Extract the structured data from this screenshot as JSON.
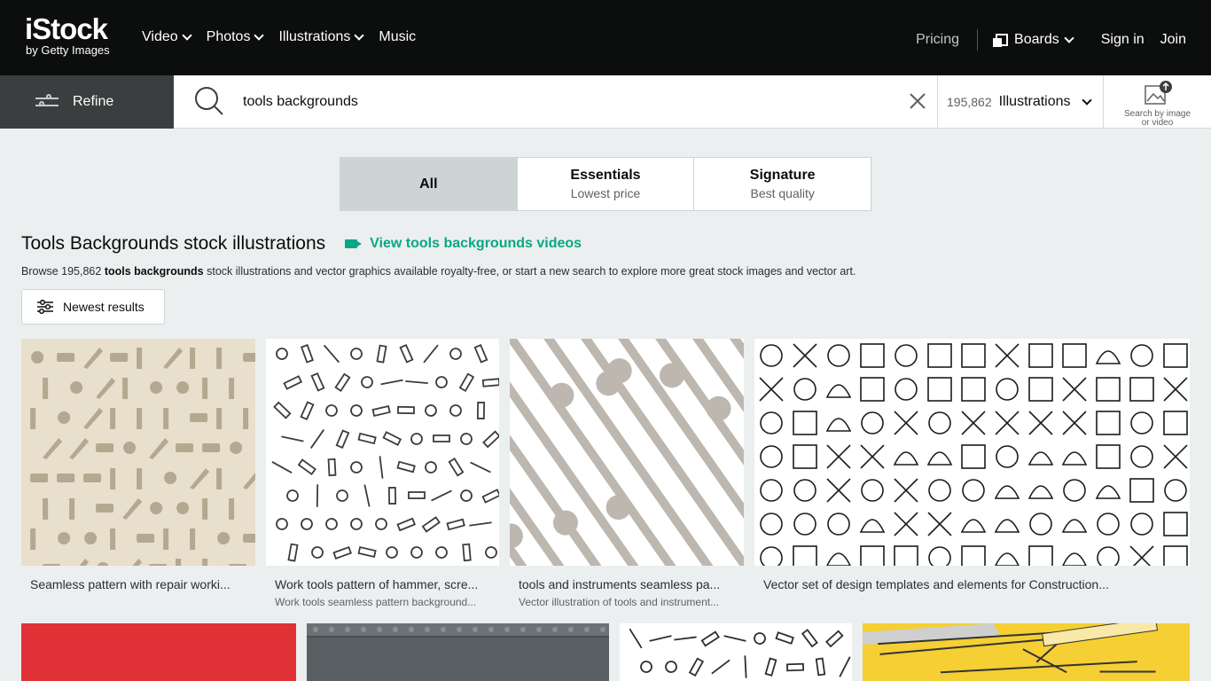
{
  "logo": {
    "main": "iStock",
    "sub": "by Getty Images"
  },
  "nav": [
    {
      "label": "Video",
      "has_menu": true
    },
    {
      "label": "Photos",
      "has_menu": true
    },
    {
      "label": "Illustrations",
      "has_menu": true
    },
    {
      "label": "Music",
      "has_menu": false
    }
  ],
  "account": {
    "pricing": "Pricing",
    "boards": "Boards",
    "signin": "Sign in",
    "join": "Join"
  },
  "search": {
    "refine": "Refine",
    "query": "tools backgrounds",
    "result_count": "195,862",
    "type": "Illustrations",
    "search_by_image_line1": "Search by image",
    "search_by_image_line2": "or video"
  },
  "tabs": [
    {
      "title": "All",
      "subtitle": ""
    },
    {
      "title": "Essentials",
      "subtitle": "Lowest price"
    },
    {
      "title": "Signature",
      "subtitle": "Best quality"
    }
  ],
  "results": {
    "title": "Tools Backgrounds stock illustrations",
    "videos_link": "View tools backgrounds videos",
    "desc_pre": "Browse 195,862 ",
    "desc_bold": "tools backgrounds",
    "desc_post": " stock illustrations and vector graphics available royalty-free, or start a new search to explore more great stock images and vector art.",
    "sort": "Newest results"
  },
  "images": [
    {
      "caption": "Seamless pattern with repair worki...",
      "subcaption": "",
      "bg": "#e8dfcc",
      "fg": "#b4a890",
      "motif": "silhouette"
    },
    {
      "caption": "Work tools pattern of hammer, scre...",
      "subcaption": "Work tools seamless pattern background...",
      "bg": "#ffffff",
      "fg": "#3c3c3c",
      "motif": "outline"
    },
    {
      "caption": "tools and instruments seamless pa...",
      "subcaption": "Vector illustration of tools and instrument...",
      "bg": "#ffffff",
      "fg": "#bdb7b0",
      "motif": "diagonal"
    },
    {
      "caption": "Vector set of design templates and elements for Construction...",
      "subcaption": "",
      "bg": "#ffffff",
      "fg": "#1c1c1c",
      "motif": "icons"
    },
    {
      "caption": "",
      "subcaption": "",
      "bg": "#e03236",
      "fg": "#e03236",
      "motif": "plain"
    },
    {
      "caption": "",
      "subcaption": "",
      "bg": "#4a4f53",
      "fg": "#8a8f94",
      "motif": "metal"
    },
    {
      "caption": "",
      "subcaption": "",
      "bg": "#ffffff",
      "fg": "#2e2e2e",
      "motif": "outline"
    },
    {
      "caption": "",
      "subcaption": "",
      "bg": "#f5cf33",
      "fg": "#cfcfcf",
      "motif": "yellow"
    }
  ]
}
